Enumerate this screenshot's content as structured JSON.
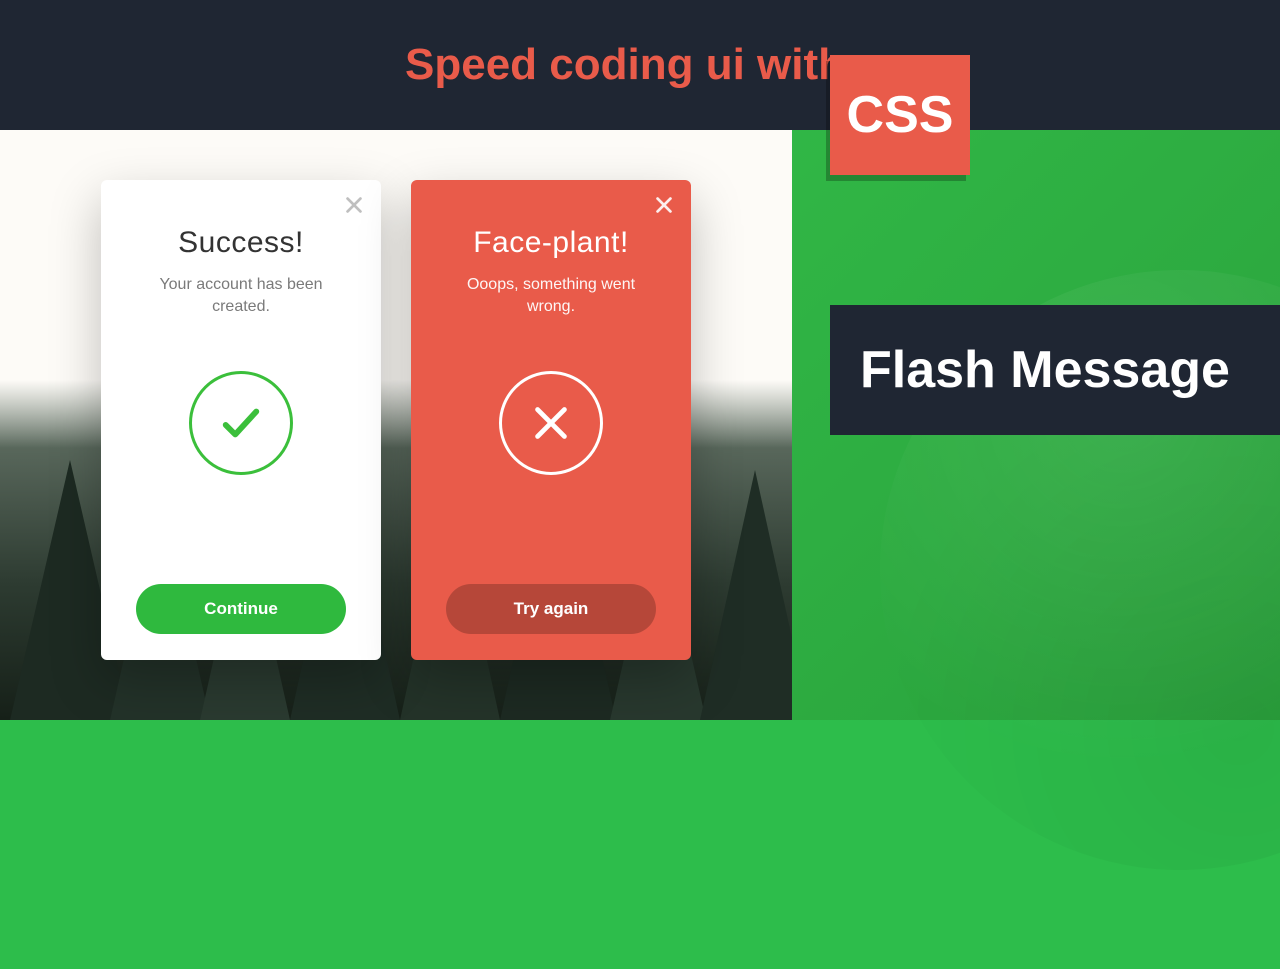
{
  "header": {
    "title": "Speed coding ui with",
    "badge": "CSS"
  },
  "subtitleBar": {
    "label": "Flash Message"
  },
  "colors": {
    "accentGreen": "#2fb93e",
    "accentRed": "#e95b4a",
    "dark": "#1f2633"
  },
  "cards": {
    "success": {
      "title": "Success!",
      "body": "Your account has been created.",
      "button": "Continue",
      "iconName": "check-icon"
    },
    "error": {
      "title": "Face-plant!",
      "body": "Ooops, something went wrong.",
      "button": "Try again",
      "iconName": "cross-icon"
    }
  }
}
